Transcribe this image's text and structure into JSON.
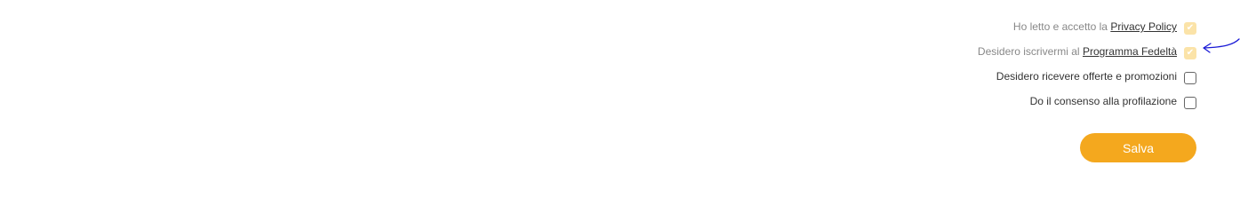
{
  "consents": [
    {
      "text_before": "Ho letto e accetto la",
      "link_label": "Privacy Policy",
      "checked": true,
      "disabled": true
    },
    {
      "text_before": "Desidero iscrivermi al",
      "link_label": "Programma Fedeltà",
      "checked": true,
      "disabled": true
    },
    {
      "text": "Desidero ricevere offerte e promozioni",
      "checked": false,
      "disabled": false
    },
    {
      "text": "Do il consenso alla profilazione",
      "checked": false,
      "disabled": false
    }
  ],
  "icons": {
    "check": "✔",
    "annotation_arrow": "hand-drawn-arrow-icon"
  },
  "colors": {
    "accent": "#f4a81e",
    "checkbox_checked_disabled": "#fbe3a8",
    "annotation": "#1a1ad6"
  },
  "save_button": {
    "label": "Salva"
  }
}
